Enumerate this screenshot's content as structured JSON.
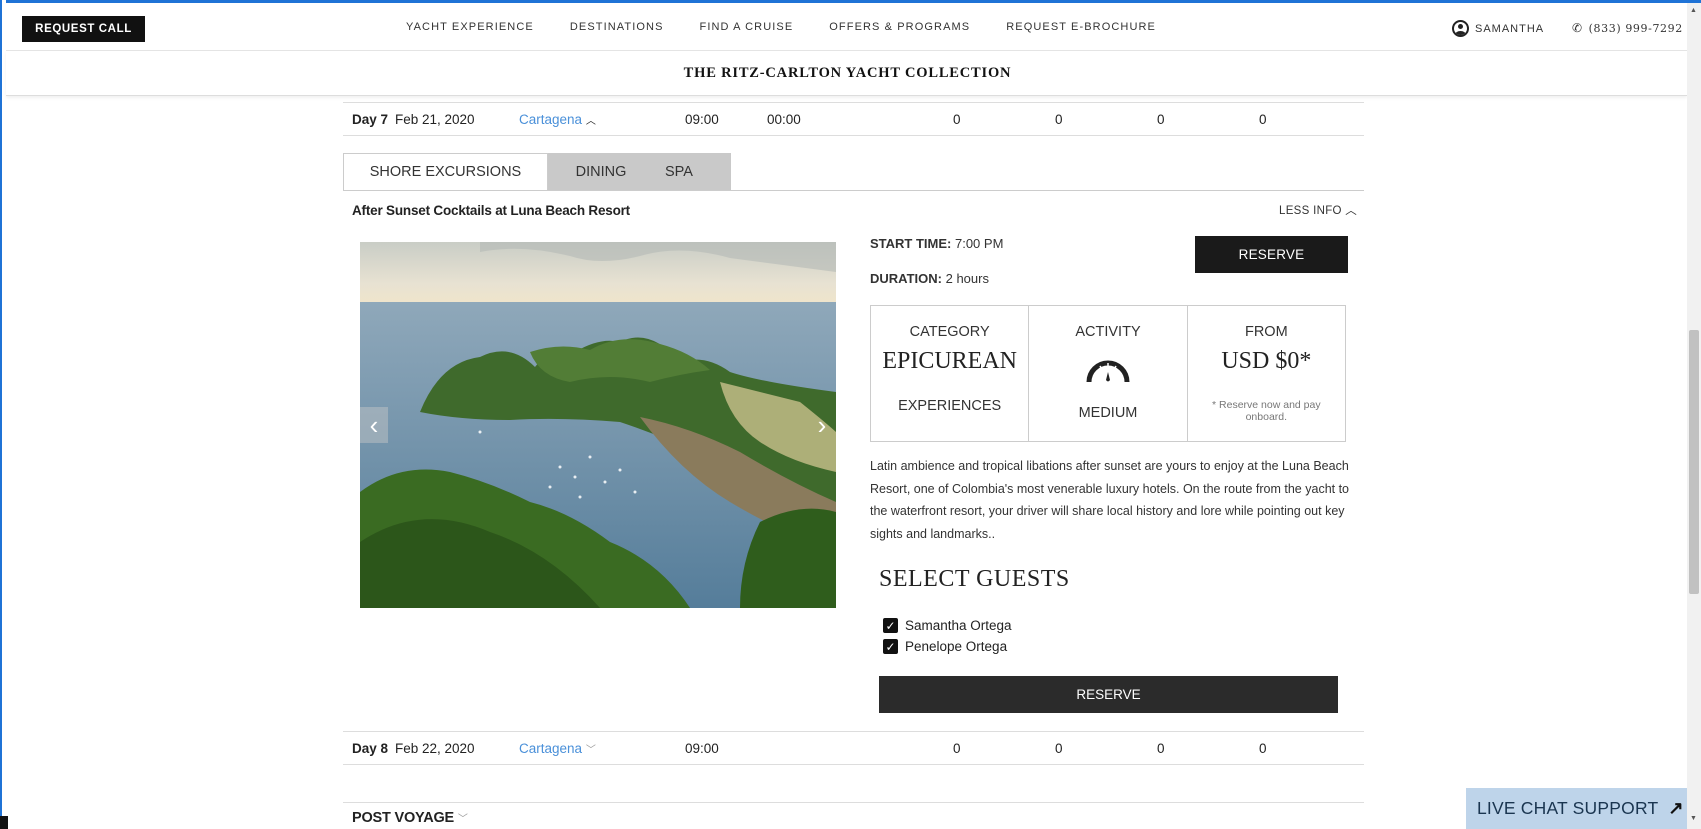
{
  "header": {
    "request_call": "REQUEST CALL",
    "nav": [
      "YACHT EXPERIENCE",
      "DESTINATIONS",
      "FIND A CRUISE",
      "OFFERS & PROGRAMS",
      "REQUEST E-BROCHURE"
    ],
    "user_name": "SAMANTHA",
    "phone": "(833) 999-7292",
    "brand": "THE RITZ-CARLTON YACHT COLLECTION"
  },
  "itinerary": {
    "day7": {
      "day": "Day 7",
      "date": "Feb 21, 2020",
      "port": "Cartagena",
      "arrive": "09:00",
      "depart": "00:00",
      "c1": "0",
      "c2": "0",
      "c3": "0",
      "c4": "0"
    },
    "day8": {
      "day": "Day 8",
      "date": "Feb 22, 2020",
      "port": "Cartagena",
      "arrive": "09:00",
      "c1": "0",
      "c2": "0",
      "c3": "0",
      "c4": "0"
    }
  },
  "tabs": [
    "SHORE EXCURSIONS",
    "DINING",
    "SPA"
  ],
  "excursion": {
    "title": "After Sunset Cocktails at Luna Beach Resort",
    "less_info": "LESS INFO",
    "start_time_label": "START TIME:",
    "start_time": "7:00 PM",
    "duration_label": "DURATION:",
    "duration": "2 hours",
    "reserve": "RESERVE",
    "category_label": "CATEGORY",
    "category_big": "EPICUREAN",
    "category_sub": "EXPERIENCES",
    "activity_label": "ACTIVITY",
    "activity_icon": "gauge-icon",
    "activity_level": "MEDIUM",
    "from_label": "FROM",
    "price": "USD $0*",
    "price_note": "* Reserve now and pay onboard.",
    "description": "Latin ambience and tropical libations after sunset are yours to enjoy at the Luna Beach Resort, one of Colombia's most venerable luxury hotels. On the route from the yacht to the waterfront resort, your driver will share local history and lore while pointing out key sights and landmarks.."
  },
  "guests": {
    "title": "SELECT GUESTS",
    "list": [
      {
        "name": "Samantha Ortega",
        "checked": true
      },
      {
        "name": "Penelope Ortega",
        "checked": true
      }
    ],
    "reserve": "RESERVE"
  },
  "post_voyage": "POST VOYAGE",
  "chat": "LIVE CHAT SUPPORT",
  "colors": {
    "accent_link": "#4a90d9",
    "button_dark": "#1a1a1a",
    "chat_bg": "#bed4ea",
    "frame_blue": "#1f73d6"
  }
}
